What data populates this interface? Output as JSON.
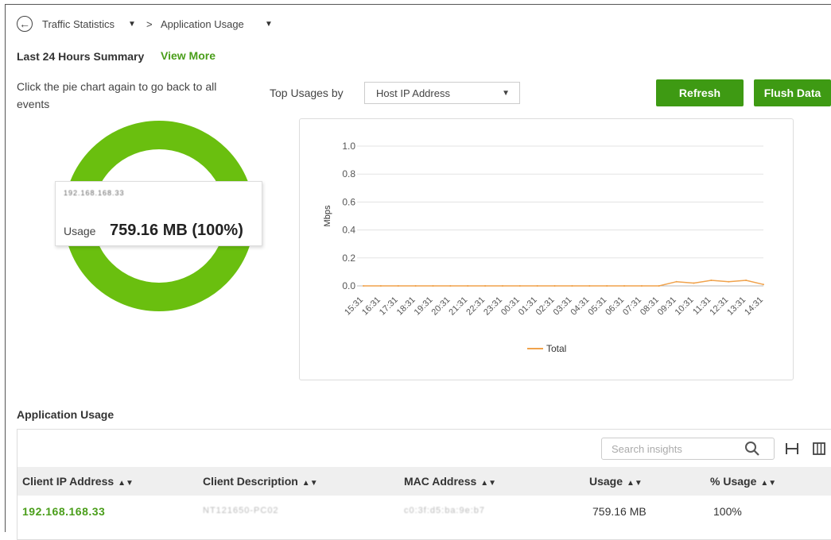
{
  "breadcrumb": {
    "item1": "Traffic Statistics",
    "separator": ">",
    "item2": "Application Usage"
  },
  "summary": {
    "title": "Last 24 Hours Summary",
    "view_more": "View More",
    "hint": "Click the pie chart again to go back to all events"
  },
  "controls": {
    "top_usages_label": "Top Usages by",
    "select_value": "Host IP Address",
    "refresh_label": "Refresh",
    "flush_label": "Flush Data"
  },
  "pie": {
    "tooltip_ip": "192.168.168.33",
    "usage_label": "Usage",
    "usage_value": "759.16 MB (100%)",
    "color": "#6abf0f",
    "chart_data": {
      "type": "pie",
      "slices": [
        {
          "label": "192.168.168.33",
          "value": 100
        }
      ]
    }
  },
  "chart_data": {
    "type": "line",
    "ylabel": "Mbps",
    "ylim": [
      0,
      1.0
    ],
    "yticks": [
      "0.0",
      "0.2",
      "0.4",
      "0.6",
      "0.8",
      "1.0"
    ],
    "categories": [
      "15:31",
      "16:31",
      "17:31",
      "18:31",
      "19:31",
      "20:31",
      "21:31",
      "22:31",
      "23:31",
      "00:31",
      "01:31",
      "02:31",
      "03:31",
      "04:31",
      "05:31",
      "06:31",
      "07:31",
      "08:31",
      "09:31",
      "10:31",
      "11:31",
      "12:31",
      "13:31",
      "14:31"
    ],
    "series": [
      {
        "name": "Total",
        "color": "#f0a24b",
        "values": [
          0,
          0,
          0,
          0,
          0,
          0,
          0,
          0,
          0,
          0,
          0,
          0,
          0,
          0,
          0,
          0,
          0,
          0,
          0.03,
          0.02,
          0.04,
          0.03,
          0.04,
          0.01
        ]
      }
    ],
    "legend": "bottom"
  },
  "table": {
    "title": "Application Usage",
    "search_placeholder": "Search insights",
    "columns": [
      "Client IP Address",
      "Client Description",
      "MAC Address",
      "Usage",
      "% Usage"
    ],
    "rows": [
      {
        "ip": "192.168.168.33",
        "description": "NT121650-PC02",
        "mac": "c0:3f:d5:ba:9e:b7",
        "usage": "759.16 MB",
        "percent": "100%"
      }
    ]
  }
}
